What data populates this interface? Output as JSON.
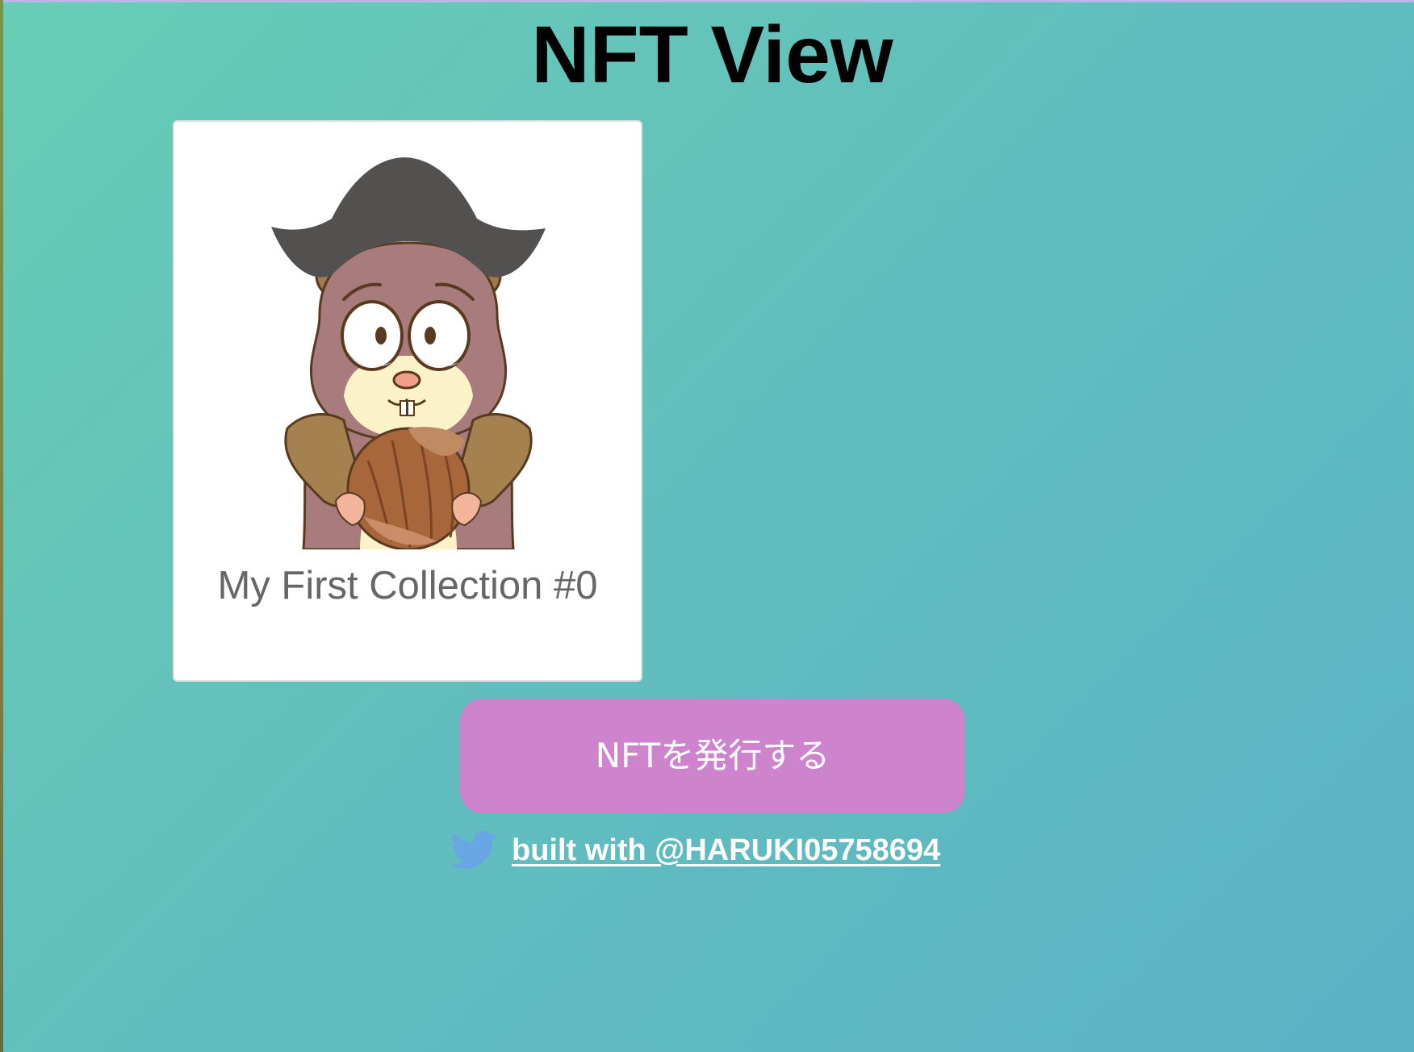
{
  "page": {
    "title": "NFT View"
  },
  "nft_cards": [
    {
      "name": "My First Collection #0",
      "image_icon": "hamster-with-hazelnut-illustration"
    }
  ],
  "mint_button": {
    "label": "NFTを発行する"
  },
  "footer": {
    "icon": "twitter-bird-icon",
    "link_text": "built with @HARUKI05758694"
  },
  "colors": {
    "background_start": "#68cdb5",
    "background_end": "#5bb2c6",
    "button": "#ce84cc",
    "card": "#ffffff",
    "twitter_blue": "#6aa6e6"
  }
}
